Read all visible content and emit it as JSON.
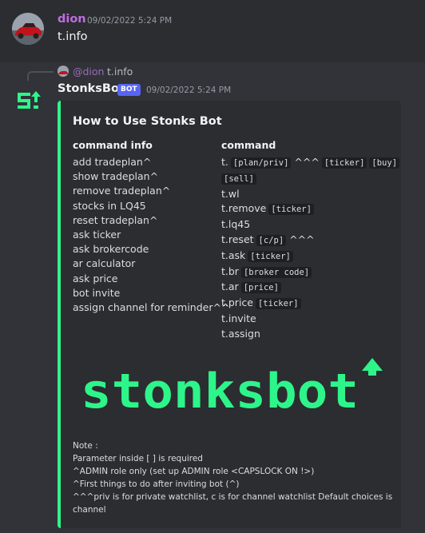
{
  "message1": {
    "author": "dion",
    "timestamp": "09/02/2022 5:24 PM",
    "content": "t.info",
    "author_color": "#c06ce0"
  },
  "message2": {
    "reply": {
      "author": "@dion",
      "content": "t.info"
    },
    "author": "StonksBot",
    "badge": "BOT",
    "timestamp": "09/02/2022 5:24 PM",
    "embed": {
      "accent_color": "#2ef58a",
      "title": "How to Use Stonks Bot",
      "left_header": "command info",
      "right_header": "command",
      "left_items": [
        "add tradeplan^",
        "show tradeplan^",
        "remove tradeplan^",
        "stocks in LQ45",
        "reset tradeplan^",
        "ask ticker",
        "ask brokercode",
        "ar calculator",
        "ask price",
        "bot invite",
        "assign channel for reminder^^"
      ],
      "right_items": [
        {
          "cmd": "t.",
          "code": "[plan/priv]",
          "suffix": "^^^",
          "code2": "[ticker]",
          "code3": "[buy]"
        },
        {
          "cmd": "",
          "code": "[sell]"
        },
        {
          "cmd": "t.wl"
        },
        {
          "cmd": "t.remove",
          "code": "[ticker]"
        },
        {
          "cmd": "t.lq45"
        },
        {
          "cmd": "t.reset",
          "code": "[c/p]",
          "suffix": "^^^"
        },
        {
          "cmd": "t.ask",
          "code": "[ticker]"
        },
        {
          "cmd": "t.br",
          "code": "[broker code]"
        },
        {
          "cmd": "t.ar",
          "code": "[price]"
        },
        {
          "cmd": "t.price",
          "code": "[ticker]"
        },
        {
          "cmd": "t.invite"
        },
        {
          "cmd": "t.assign"
        }
      ],
      "logo_text": "stonksbot",
      "note_lines": [
        "Note :",
        "Parameter inside [ ] is required",
        "^ADMIN role only (set up ADMIN role <CAPSLOCK ON !>)",
        "^First things to do after inviting bot (^)",
        "^^^priv is for private watchlist, c is for channel watchlist Default choices is channel"
      ]
    }
  }
}
